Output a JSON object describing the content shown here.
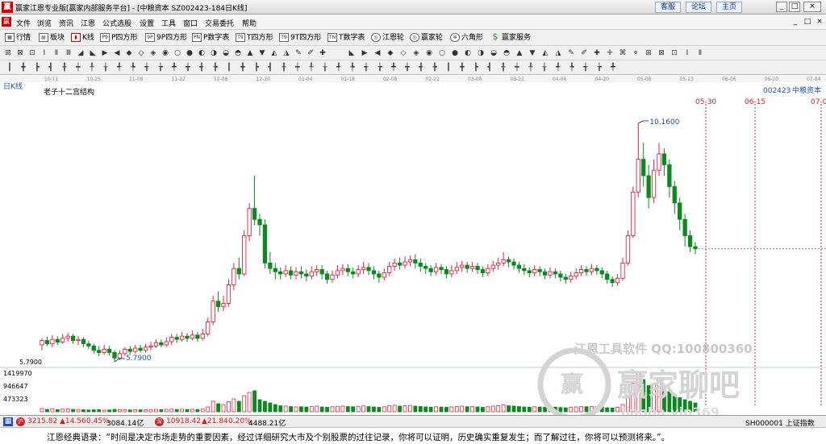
{
  "titlebar": {
    "logo": "赢",
    "title": "赢家江恩专业版[赢家内部服务平台] - [中粮资本  SZ002423-184日K线]",
    "links": [
      "客服",
      "论坛",
      "主页"
    ],
    "window_buttons": [
      "_",
      "□",
      "×"
    ]
  },
  "menubar": {
    "logo": "赢",
    "items": [
      "文件",
      "浏览",
      "资讯",
      "江恩",
      "公式选股",
      "设置",
      "工具",
      "窗口",
      "交易委托",
      "帮助"
    ],
    "right_buttons": [
      "_",
      "□",
      "×"
    ]
  },
  "toolbar_main": {
    "items": [
      {
        "label": "行情",
        "icon": "grid-icon"
      },
      {
        "label": "板块",
        "icon": "blocks-icon"
      },
      {
        "label": "K线",
        "icon": "kline-icon"
      },
      {
        "label": "P四方形",
        "icon": "P9"
      },
      {
        "label": "9P四方形",
        "icon": "9P"
      },
      {
        "label": "P数字表",
        "icon": "PN"
      },
      {
        "label": "T四方形",
        "icon": "T9"
      },
      {
        "label": "9T四方形",
        "icon": "T9"
      },
      {
        "label": "T数字表",
        "icon": "TN"
      },
      {
        "label": "江恩轮",
        "icon": "wheel-icon"
      },
      {
        "label": "赢家轮",
        "icon": "wheel-icon"
      },
      {
        "label": "六角形",
        "icon": "hexagon-icon"
      },
      {
        "label": "赢家服务",
        "icon": "dollar-icon"
      }
    ]
  },
  "chart_panel": {
    "period_label": "日K线",
    "study_label": "老子十二宫结构",
    "stock_code": "002423",
    "stock_name": "中粮资本",
    "date_axis": [
      "10-11",
      "10-25",
      "11-08",
      "11-22",
      "12-06",
      "12-20",
      "01-04",
      "01-18",
      "02-08",
      "02-22",
      "03-08",
      "03-22",
      "04-06",
      "04-20",
      "05-08",
      "05-23",
      "06-06",
      "06-20",
      "07-04"
    ],
    "forecast_dates": [
      "05-30",
      "06-15",
      "07-0"
    ],
    "high_label": "10.1600",
    "low_label": "5.7900",
    "price_axis_low": "5.7900",
    "volume_axis": [
      "1419970",
      "946647",
      "473323"
    ],
    "watermark_tool": "江恩工具软件  QQ:100800360",
    "watermark_brand": "赢家聊吧",
    "watermark_url": "liaoba.vip369",
    "colors": {
      "up": "#e8203c",
      "down": "#0a8a1e",
      "axis": "#1f4fb0",
      "forecast": "#d21f1f"
    }
  },
  "statusbar": {
    "sh_index": "3215.82",
    "sh_change": "▲14.56",
    "sh_pct": "0.45%",
    "sh_amount": "3084.14亿",
    "sz_index": "10918.42",
    "sz_change": "▲21.84",
    "sz_pct": "0.20%",
    "sz_amount": "4488.21亿",
    "right_text": "SH000001 上证指数"
  },
  "quote": {
    "text": "江恩经典语录：“时间是决定市场走势的重要因素，经过详细研究大市及个别股票的过往记录，你将可以证明，历史确实重复发生；而了解过往，你将可以预测将来。”。"
  },
  "chart_data": {
    "type": "candlestick",
    "title": "老子十二宫结构",
    "xlabel": "",
    "ylabel": "",
    "period": "日K线",
    "x_ticks": [
      "10-11",
      "10-25",
      "11-08",
      "11-22",
      "12-06",
      "12-20",
      "01-04",
      "01-18",
      "02-08",
      "02-22",
      "03-08",
      "03-22",
      "04-06",
      "04-20",
      "05-08",
      "05-23",
      "06-06",
      "06-20",
      "07-04"
    ],
    "price_high": 10.16,
    "price_low": 5.79,
    "series": [
      {
        "name": "中粮资本",
        "values": [
          [
            6.1,
            6.18,
            6.22,
            6.0
          ],
          [
            6.18,
            6.12,
            6.25,
            6.08
          ],
          [
            6.12,
            6.2,
            6.28,
            6.06
          ],
          [
            6.2,
            6.15,
            6.26,
            6.1
          ],
          [
            6.15,
            6.22,
            6.3,
            6.12
          ],
          [
            6.22,
            6.26,
            6.32,
            6.16
          ],
          [
            6.26,
            6.18,
            6.3,
            6.12
          ],
          [
            6.18,
            6.2,
            6.26,
            6.1
          ],
          [
            6.2,
            6.12,
            6.24,
            6.06
          ],
          [
            6.12,
            6.08,
            6.18,
            6.02
          ],
          [
            6.08,
            6.0,
            6.12,
            5.94
          ],
          [
            6.0,
            5.96,
            6.08,
            5.9
          ],
          [
            5.96,
            6.02,
            6.1,
            5.92
          ],
          [
            6.02,
            5.96,
            6.08,
            5.9
          ],
          [
            5.96,
            5.86,
            6.0,
            5.79
          ],
          [
            5.86,
            5.94,
            6.0,
            5.82
          ],
          [
            5.94,
            6.02,
            6.06,
            5.9
          ],
          [
            6.02,
            5.98,
            6.08,
            5.92
          ],
          [
            5.98,
            6.04,
            6.1,
            5.94
          ],
          [
            6.04,
            6.0,
            6.1,
            5.96
          ],
          [
            6.0,
            6.06,
            6.12,
            5.96
          ],
          [
            6.06,
            6.08,
            6.16,
            6.0
          ],
          [
            6.08,
            6.14,
            6.2,
            6.04
          ],
          [
            6.14,
            6.1,
            6.2,
            6.06
          ],
          [
            6.1,
            6.16,
            6.24,
            6.06
          ],
          [
            6.16,
            6.24,
            6.3,
            6.1
          ],
          [
            6.24,
            6.2,
            6.3,
            6.14
          ],
          [
            6.2,
            6.26,
            6.34,
            6.16
          ],
          [
            6.26,
            6.22,
            6.32,
            6.16
          ],
          [
            6.22,
            6.28,
            6.36,
            6.18
          ],
          [
            6.28,
            6.22,
            6.34,
            6.16
          ],
          [
            6.22,
            6.3,
            6.4,
            6.18
          ],
          [
            6.3,
            6.52,
            6.6,
            6.26
          ],
          [
            6.52,
            6.9,
            7.0,
            6.46
          ],
          [
            6.9,
            6.8,
            7.08,
            6.7
          ],
          [
            6.8,
            6.86,
            7.0,
            6.72
          ],
          [
            6.86,
            7.2,
            7.3,
            6.8
          ],
          [
            7.2,
            7.5,
            7.6,
            7.1
          ],
          [
            7.5,
            7.4,
            7.7,
            7.3
          ],
          [
            7.4,
            8.1,
            8.2,
            7.36
          ],
          [
            8.1,
            8.6,
            8.7,
            8.0
          ],
          [
            8.6,
            8.4,
            9.2,
            8.3
          ],
          [
            8.4,
            8.3,
            8.5,
            8.1
          ],
          [
            8.3,
            7.6,
            8.4,
            7.5
          ],
          [
            7.6,
            7.5,
            7.8,
            7.4
          ],
          [
            7.5,
            7.44,
            7.6,
            7.3
          ],
          [
            7.44,
            7.4,
            7.52,
            7.3
          ],
          [
            7.4,
            7.46,
            7.56,
            7.34
          ],
          [
            7.46,
            7.38,
            7.54,
            7.3
          ],
          [
            7.38,
            7.44,
            7.52,
            7.3
          ],
          [
            7.44,
            7.4,
            7.54,
            7.32
          ],
          [
            7.4,
            7.36,
            7.48,
            7.26
          ],
          [
            7.36,
            7.44,
            7.54,
            7.3
          ],
          [
            7.44,
            7.48,
            7.56,
            7.36
          ],
          [
            7.48,
            7.4,
            7.56,
            7.3
          ],
          [
            7.4,
            7.3,
            7.46,
            7.22
          ],
          [
            7.3,
            7.38,
            7.46,
            7.24
          ],
          [
            7.38,
            7.46,
            7.56,
            7.32
          ],
          [
            7.46,
            7.5,
            7.58,
            7.38
          ],
          [
            7.5,
            7.44,
            7.58,
            7.36
          ],
          [
            7.44,
            7.4,
            7.52,
            7.32
          ],
          [
            7.4,
            7.48,
            7.56,
            7.34
          ],
          [
            7.48,
            7.52,
            7.62,
            7.4
          ],
          [
            7.52,
            7.46,
            7.6,
            7.38
          ],
          [
            7.46,
            7.4,
            7.54,
            7.3
          ],
          [
            7.4,
            7.34,
            7.46,
            7.24
          ],
          [
            7.34,
            7.42,
            7.5,
            7.28
          ],
          [
            7.42,
            7.54,
            7.62,
            7.36
          ],
          [
            7.54,
            7.6,
            7.68,
            7.46
          ],
          [
            7.6,
            7.56,
            7.7,
            7.48
          ],
          [
            7.56,
            7.62,
            7.72,
            7.5
          ],
          [
            7.62,
            7.66,
            7.74,
            7.54
          ],
          [
            7.66,
            7.6,
            7.76,
            7.5
          ],
          [
            7.6,
            7.54,
            7.68,
            7.44
          ],
          [
            7.54,
            7.5,
            7.6,
            7.4
          ],
          [
            7.5,
            7.44,
            7.56,
            7.36
          ],
          [
            7.44,
            7.52,
            7.6,
            7.38
          ],
          [
            7.52,
            7.48,
            7.58,
            7.4
          ],
          [
            7.48,
            7.4,
            7.54,
            7.32
          ],
          [
            7.4,
            7.46,
            7.56,
            7.34
          ],
          [
            7.46,
            7.52,
            7.62,
            7.4
          ],
          [
            7.52,
            7.56,
            7.64,
            7.44
          ],
          [
            7.56,
            7.5,
            7.62,
            7.42
          ],
          [
            7.5,
            7.54,
            7.62,
            7.44
          ],
          [
            7.54,
            7.48,
            7.6,
            7.4
          ],
          [
            7.48,
            7.42,
            7.54,
            7.34
          ],
          [
            7.42,
            7.5,
            7.58,
            7.36
          ],
          [
            7.5,
            7.56,
            7.64,
            7.44
          ],
          [
            7.56,
            7.6,
            7.7,
            7.48
          ],
          [
            7.6,
            7.66,
            7.8,
            7.54
          ],
          [
            7.66,
            7.62,
            7.72,
            7.52
          ],
          [
            7.62,
            7.56,
            7.68,
            7.48
          ],
          [
            7.56,
            7.5,
            7.62,
            7.42
          ],
          [
            7.5,
            7.46,
            7.58,
            7.38
          ],
          [
            7.46,
            7.42,
            7.52,
            7.34
          ],
          [
            7.42,
            7.48,
            7.56,
            7.36
          ],
          [
            7.48,
            7.44,
            7.54,
            7.36
          ],
          [
            7.44,
            7.38,
            7.5,
            7.3
          ],
          [
            7.38,
            7.44,
            7.52,
            7.32
          ],
          [
            7.44,
            7.4,
            7.5,
            7.32
          ],
          [
            7.4,
            7.34,
            7.46,
            7.26
          ],
          [
            7.34,
            7.3,
            7.4,
            7.22
          ],
          [
            7.3,
            7.36,
            7.44,
            7.24
          ],
          [
            7.36,
            7.42,
            7.5,
            7.3
          ],
          [
            7.42,
            7.48,
            7.56,
            7.36
          ],
          [
            7.48,
            7.44,
            7.54,
            7.36
          ],
          [
            7.44,
            7.5,
            7.58,
            7.38
          ],
          [
            7.5,
            7.46,
            7.56,
            7.38
          ],
          [
            7.46,
            7.4,
            7.52,
            7.32
          ],
          [
            7.4,
            7.3,
            7.46,
            7.22
          ],
          [
            7.3,
            7.24,
            7.36,
            7.16
          ],
          [
            7.24,
            7.32,
            7.4,
            7.18
          ],
          [
            7.32,
            7.6,
            7.7,
            7.28
          ],
          [
            7.6,
            8.1,
            8.2,
            7.56
          ],
          [
            8.1,
            8.9,
            9.0,
            8.06
          ],
          [
            8.9,
            9.5,
            10.16,
            8.8
          ],
          [
            9.5,
            9.2,
            9.8,
            9.0
          ],
          [
            9.2,
            8.8,
            9.4,
            8.6
          ],
          [
            8.8,
            9.3,
            9.5,
            8.7
          ],
          [
            9.3,
            9.6,
            9.8,
            9.2
          ],
          [
            9.6,
            9.4,
            9.7,
            9.2
          ],
          [
            9.4,
            9.0,
            9.5,
            8.8
          ],
          [
            9.0,
            8.7,
            9.1,
            8.5
          ],
          [
            8.7,
            8.4,
            8.8,
            8.2
          ],
          [
            8.4,
            8.1,
            8.5,
            7.9
          ],
          [
            8.1,
            7.9,
            8.2,
            7.8
          ],
          [
            7.9,
            7.86,
            7.98,
            7.76
          ]
        ]
      }
    ],
    "volume_axis_ticks": [
      1419970,
      946647,
      473323
    ],
    "volumes": [
      80,
      60,
      70,
      55,
      65,
      70,
      60,
      55,
      50,
      45,
      48,
      52,
      40,
      45,
      60,
      55,
      50,
      45,
      52,
      48,
      50,
      55,
      58,
      52,
      60,
      65,
      58,
      62,
      55,
      60,
      58,
      65,
      120,
      260,
      200,
      180,
      250,
      320,
      260,
      400,
      480,
      520,
      300,
      260,
      220,
      180,
      150,
      140,
      130,
      120,
      125,
      118,
      130,
      140,
      120,
      110,
      125,
      135,
      140,
      130,
      125,
      135,
      145,
      130,
      120,
      110,
      125,
      150,
      160,
      140,
      150,
      155,
      140,
      130,
      120,
      115,
      125,
      118,
      110,
      120,
      130,
      140,
      125,
      130,
      120,
      110,
      125,
      140,
      150,
      170,
      150,
      140,
      130,
      120,
      115,
      125,
      118,
      110,
      120,
      115,
      105,
      100,
      110,
      120,
      130,
      125,
      130,
      125,
      115,
      100,
      95,
      110,
      180,
      400,
      700,
      1000,
      800,
      650,
      700,
      800,
      600,
      500,
      400,
      350,
      300,
      260,
      220
    ],
    "volume_max": 1419970
  }
}
